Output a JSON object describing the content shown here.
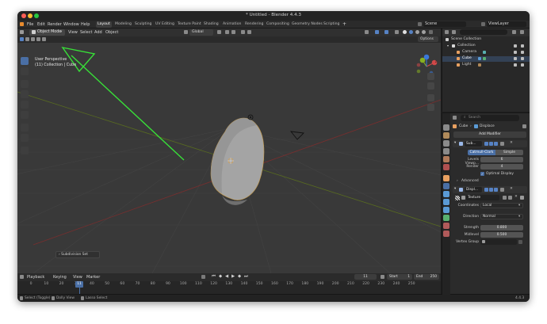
{
  "window": {
    "title": "* Untitled - Blender 4.4.3"
  },
  "topbar": {
    "menus": [
      "File",
      "Edit",
      "Render",
      "Window",
      "Help"
    ],
    "workspace_tabs": [
      "Layout",
      "Modeling",
      "Sculpting",
      "UV Editing",
      "Texture Paint",
      "Shading",
      "Animation",
      "Rendering",
      "Compositing",
      "Geometry Nodes",
      "Scripting"
    ],
    "active_tab": "Layout",
    "scene_label": "Scene",
    "view_layer_label": "ViewLayer"
  },
  "viewport_header": {
    "mode_label": "Object Mode",
    "menus": [
      "View",
      "Select",
      "Add",
      "Object"
    ],
    "transform_orientation": "Global",
    "options_label": "Options"
  },
  "viewport": {
    "perspective_label": "User Perspective",
    "context_label": "(11) Collection | Cube",
    "last_operator": "Subdivision Set",
    "gizmo_axes": [
      "X",
      "Y",
      "Z"
    ]
  },
  "timeline": {
    "menus": [
      "Playback",
      "Keying",
      "View",
      "Marker"
    ],
    "current_frame": "11",
    "start_label": "Start",
    "start_value": "1",
    "end_label": "End",
    "end_value": "250",
    "ticks": [
      "0",
      "10",
      "20",
      "30",
      "40",
      "50",
      "60",
      "70",
      "80",
      "90",
      "100",
      "110",
      "120",
      "130",
      "140",
      "150",
      "160",
      "170",
      "180",
      "190",
      "200",
      "210",
      "220",
      "230",
      "240",
      "250"
    ],
    "current_tick": "11"
  },
  "statusbar": {
    "left": "Select (Toggle)",
    "middle": "Dolly View",
    "right": "Lasso Select",
    "version": "4.4.3"
  },
  "outliner": {
    "title": "Scene Collection",
    "items": [
      {
        "label": "Collection",
        "color": "#d8d8d8"
      },
      {
        "label": "Camera",
        "color": "#e8a060"
      },
      {
        "label": "Cube",
        "color": "#e8a060"
      },
      {
        "label": "Light",
        "color": "#e8a060"
      }
    ]
  },
  "properties": {
    "search_placeholder": "Search",
    "breadcrumb_object": "Cube",
    "breadcrumb_modifier": "Displace",
    "add_modifier_label": "Add Modifier",
    "subsurf": {
      "name": "Sub...",
      "type_catmull": "Catmull-Clark",
      "type_simple": "Simple",
      "levels_label": "Levels Viewp...",
      "levels_value": "6",
      "render_label": "Render",
      "render_value": "4",
      "optimal_label": "Optimal Display",
      "advanced_label": "Advanced"
    },
    "displace": {
      "name": "Displ...",
      "texture_label": "Texture",
      "coordinates_label": "Coordinates",
      "coordinates_value": "Local",
      "direction_label": "Direction",
      "direction_value": "Normal",
      "strength_label": "Strength",
      "strength_value": "0.800",
      "midlevel_label": "Midlevel",
      "midlevel_value": "0.500",
      "vertex_group_label": "Vertex Group"
    }
  },
  "colors": {
    "accent": "#4a6fa5",
    "annotation": "#38e038",
    "x_axis": "#d04848",
    "y_axis": "#88b020",
    "z_axis": "#3a78d8",
    "playhead": "#4a6fa5"
  }
}
